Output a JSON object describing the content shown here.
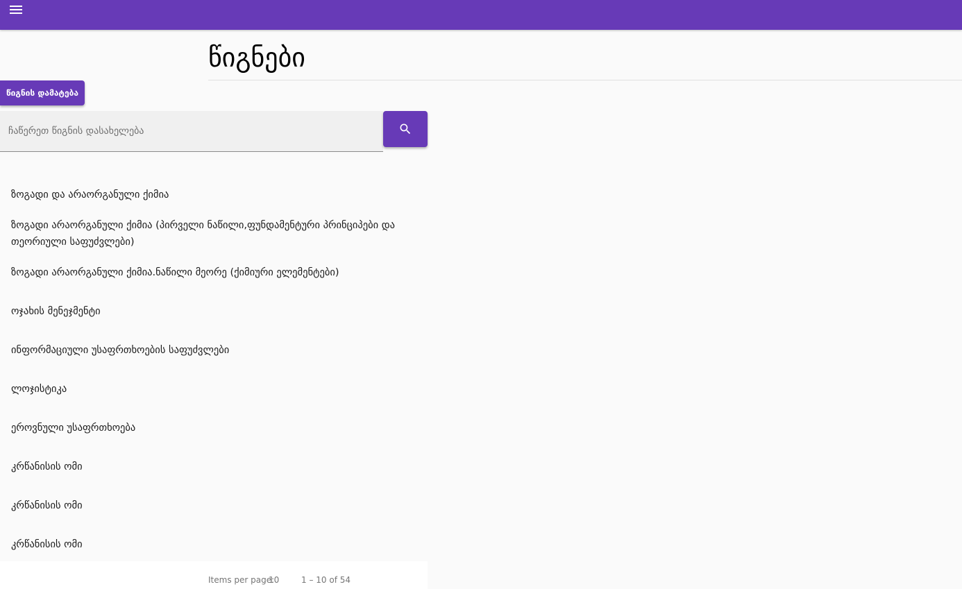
{
  "header": {
    "menu_icon": "menu-icon",
    "bar_color": "#673ab7"
  },
  "page": {
    "title": "წიგნები"
  },
  "actions": {
    "add_book_label": "წიგნის დამატება"
  },
  "search": {
    "placeholder": "ჩაწერეთ წიგნის დასახელება",
    "value": "",
    "button_icon": "search-icon"
  },
  "books": [
    {
      "title": "ზოგადი და არაორგანული ქიმია"
    },
    {
      "title": "ზოგადი არაორგანული ქიმია (პირველი ნაწილი,ფუნდამენტური პრინციპები და თეორიული საფუძვლები)"
    },
    {
      "title": "ზოგადი არაორგანული ქიმია.ნაწილი მეორე (ქიმიური ელემენტები)"
    },
    {
      "title": "ოჯახის მენეჯმენტი"
    },
    {
      "title": "ინფორმაციული უსაფრთხოების საფუძვლები"
    },
    {
      "title": "ლოჯისტიკა"
    },
    {
      "title": "ეროვნული უსაფრთხოება"
    },
    {
      "title": "კრწანისის ომი"
    },
    {
      "title": "კრწანისის ომი"
    },
    {
      "title": "კრწანისის ომი"
    }
  ],
  "paginator": {
    "items_per_page_label": "Items per page:",
    "page_size": "10",
    "range_label": "1 – 10 of 54"
  }
}
